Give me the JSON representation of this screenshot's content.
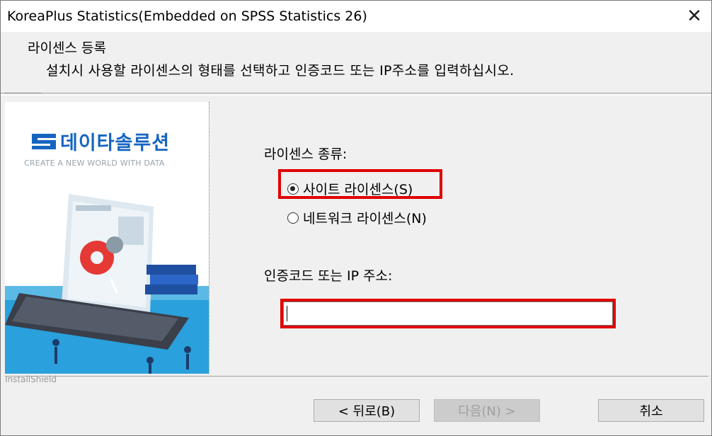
{
  "window": {
    "title": "KoreaPlus Statistics(Embedded on SPSS Statistics 26)",
    "close_glyph": "✕"
  },
  "header": {
    "title": "라이센스 등록",
    "description": "설치시 사용할 라이센스의 형태를 선택하고 인증코드 또는 IP주소를 입력하십시오."
  },
  "banner": {
    "logo_text": "데이타솔루션",
    "logo_sub": "CREATE A NEW WORLD WITH DATA",
    "brand_color": "#1565c0",
    "installshield": "InstallShield"
  },
  "license": {
    "type_label": "라이센스 종류:",
    "options": [
      {
        "label": "사이트 라이센스(S)",
        "selected": true
      },
      {
        "label": "네트워크 라이센스(N)",
        "selected": false
      }
    ],
    "highlight_color": "#e00000"
  },
  "code": {
    "label": "인증코드 또는 IP 주소:",
    "value": ""
  },
  "buttons": {
    "back": "< 뒤로(B)",
    "next": "다음(N) >",
    "cancel": "취소"
  }
}
